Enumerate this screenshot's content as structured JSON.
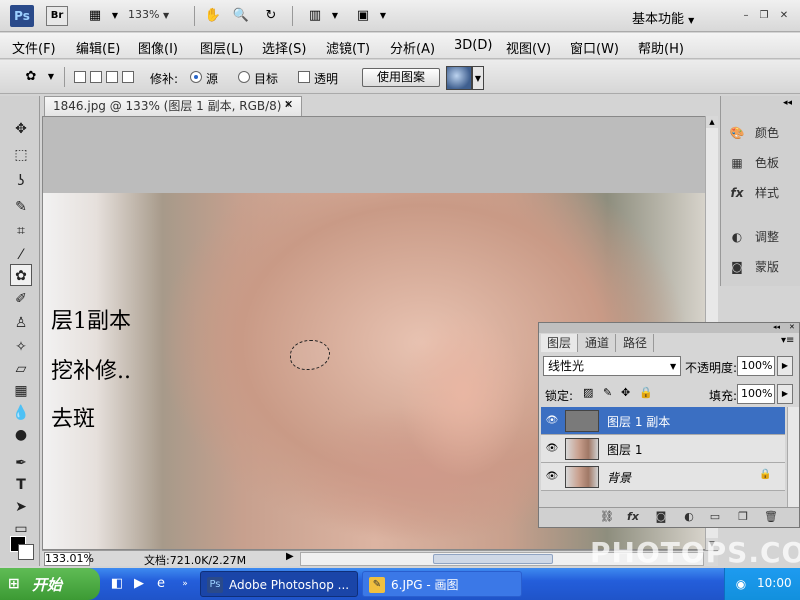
{
  "app": {
    "logo": "Ps",
    "bridge": "Br",
    "zoom": "133%",
    "workspace": "基本功能"
  },
  "menu": [
    "文件(F)",
    "编辑(E)",
    "图像(I)",
    "图层(L)",
    "选择(S)",
    "滤镜(T)",
    "分析(A)",
    "3D(D)",
    "视图(V)",
    "窗口(W)",
    "帮助(H)"
  ],
  "options": {
    "patch_label": "修补:",
    "source_label": "源",
    "target_label": "目标",
    "transparent_label": "透明",
    "use_pattern_label": "使用图案"
  },
  "document": {
    "tab_title": "1846.jpg @ 133% (图层 1 副本, RGB/8) *",
    "notes": [
      "层1副本",
      "挖补修..",
      "去斑"
    ]
  },
  "status": {
    "zoom": "133.01%",
    "doc_size": "文档:721.0K/2.27M"
  },
  "dock": {
    "items": [
      {
        "label": "颜色",
        "icon": "palette-icon"
      },
      {
        "label": "色板",
        "icon": "swatches-icon"
      },
      {
        "label": "样式",
        "icon": "styles-icon"
      },
      {
        "label": "调整",
        "icon": "adjustments-icon"
      },
      {
        "label": "蒙版",
        "icon": "masks-icon"
      }
    ]
  },
  "layers_panel": {
    "tabs": [
      "图层",
      "通道",
      "路径"
    ],
    "blend_mode": "线性光",
    "opacity_label": "不透明度:",
    "opacity": "100%",
    "lock_label": "锁定:",
    "fill_label": "填充:",
    "fill": "100%",
    "layers": [
      {
        "name": "图层 1 副本",
        "selected": true
      },
      {
        "name": "图层 1",
        "selected": false
      },
      {
        "name": "背景",
        "selected": false
      }
    ]
  },
  "taskbar": {
    "start": "开始",
    "tasks": [
      "Adobe Photoshop ...",
      "6.JPG - 画图"
    ],
    "clock": "10:00"
  },
  "watermark": "PHOTOPS.COM"
}
